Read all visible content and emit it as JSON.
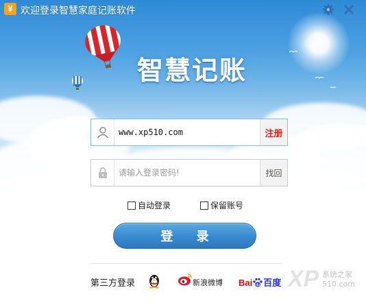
{
  "window": {
    "title": "欢迎登录智慧家庭记账软件",
    "app_logo_glyph": "¥",
    "settings_icon": "gear-icon",
    "close_icon": "close-icon"
  },
  "banner": {
    "brand_text": "智慧记账"
  },
  "username": {
    "value": "www.xp510.com",
    "icon": "user-icon",
    "side_label": "注册"
  },
  "password": {
    "placeholder": "请输入登录密码!",
    "icon": "lock-icon",
    "side_label": "找回"
  },
  "options": {
    "auto_login": {
      "label": "自动登录",
      "checked": false
    },
    "save_account": {
      "label": "保留账号",
      "checked": false
    }
  },
  "login_button": {
    "label": "登 录"
  },
  "third_party": {
    "label": "第三方登录",
    "providers": [
      {
        "icon": "qq-penguin-icon"
      },
      {
        "icon": "weibo-icon",
        "label": "新浪微博"
      },
      {
        "icon": "baidu-paw-icon",
        "label_red": "Bai",
        "label_blue": "du",
        "label_cn": "百度"
      }
    ]
  },
  "watermark": {
    "text": "XP",
    "sub": "系统之家 510.com"
  },
  "colors": {
    "accent": "#3a8bd0",
    "register": "#d6261b",
    "logo": "#f4a21e"
  }
}
